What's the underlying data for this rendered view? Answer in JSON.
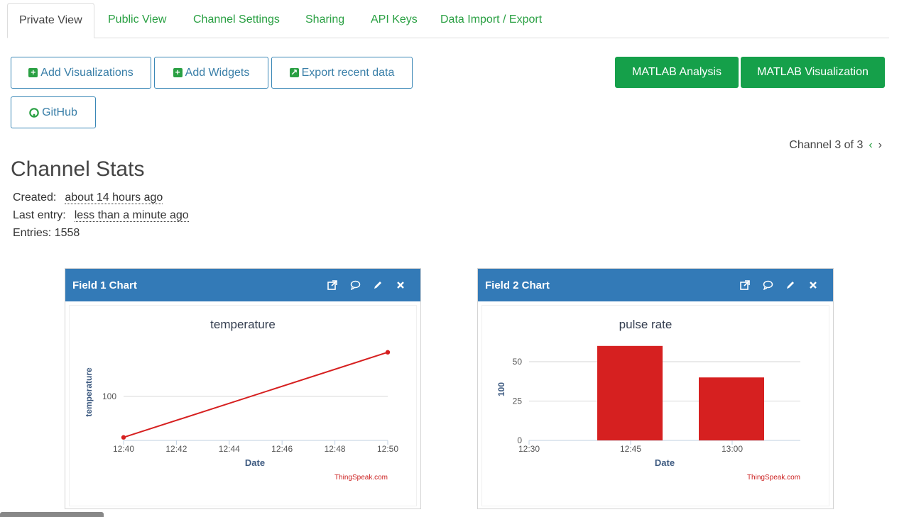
{
  "tabs": [
    {
      "label": "Private View"
    },
    {
      "label": "Public View"
    },
    {
      "label": "Channel Settings"
    },
    {
      "label": "Sharing"
    },
    {
      "label": "API Keys"
    },
    {
      "label": "Data Import / Export"
    }
  ],
  "toolbar": {
    "add_visualizations": "Add Visualizations",
    "add_widgets": "Add Widgets",
    "export_recent": "Export recent data",
    "github": "GitHub",
    "matlab_analysis": "MATLAB Analysis",
    "matlab_visualization": "MATLAB Visualization"
  },
  "pager": {
    "label": "Channel 3 of 3",
    "prev": "‹",
    "next": "›"
  },
  "stats": {
    "title": "Channel Stats",
    "created_label": "Created:",
    "created_value": "about 14 hours ago",
    "last_entry_label": "Last entry:",
    "last_entry_value": "less than a minute ago",
    "entries": "Entries: 1558"
  },
  "panels": [
    {
      "title": "Field 1 Chart"
    },
    {
      "title": "Field 2 Chart"
    }
  ],
  "colors": {
    "accent": "#337ab7",
    "green": "#15a04a",
    "series": "#d62020"
  },
  "chart_data": [
    {
      "type": "line",
      "title": "temperature",
      "xlabel": "Date",
      "ylabel": "temperature",
      "credit": "ThingSpeak.com",
      "x_ticks": [
        "12:40",
        "12:42",
        "12:44",
        "12:46",
        "12:48",
        "12:50"
      ],
      "y_ticks": [
        100
      ],
      "points": [
        {
          "x": "12:40",
          "y": 73
        },
        {
          "x": "12:50",
          "y": 129
        }
      ]
    },
    {
      "type": "bar",
      "title": "pulse rate",
      "xlabel": "Date",
      "ylabel": "100",
      "credit": "ThingSpeak.com",
      "x_ticks": [
        "12:30",
        "12:45",
        "13:00"
      ],
      "y_ticks": [
        0,
        25,
        50
      ],
      "ylim": [
        0,
        60
      ],
      "bars": [
        {
          "center": "12:45",
          "value": 60
        },
        {
          "center": "13:00",
          "value": 40
        }
      ]
    }
  ]
}
